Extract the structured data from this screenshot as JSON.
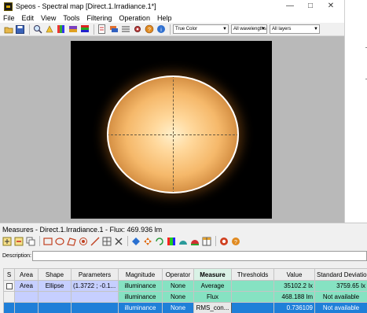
{
  "window": {
    "title": "Speos - Spectral map [Direct.1.Irradiance.1*]",
    "controls": {
      "minimize": "—",
      "maximize": "□",
      "close": "✕"
    }
  },
  "menu": [
    "File",
    "Edit",
    "View",
    "Tools",
    "Filtering",
    "Operation",
    "Help"
  ],
  "toolbar": {
    "color_mode": "True Color",
    "wavelength": "All wavelengths",
    "layers": "All layers"
  },
  "measures": {
    "title": "Measures - Direct.1.Irradiance.1 - Flux: 469.936 lm",
    "description_label": "Description:",
    "description_value": "",
    "columns": [
      "S",
      "Area",
      "Shape",
      "Parameters",
      "Magnitude",
      "Operator",
      "Measure",
      "Thresholds",
      "Value",
      "Standard Deviation"
    ],
    "rows": [
      {
        "area": "Area",
        "shape": "Ellipse",
        "parameters": "(1.3722 ; -0.1...",
        "magnitude": "illuminance",
        "operator": "None",
        "measure": "Average",
        "thresholds": "",
        "value": "35102.2 lx",
        "std_dev": "3759.65 lx"
      },
      {
        "area": "",
        "shape": "",
        "parameters": "",
        "magnitude": "illuminance",
        "operator": "None",
        "measure": "Flux",
        "thresholds": "",
        "value": "468.188 lm",
        "std_dev": "Not available"
      },
      {
        "area": "",
        "shape": "",
        "parameters": "",
        "magnitude": "illuminance",
        "operator": "None",
        "measure": "RMS_con...",
        "thresholds": "",
        "value": "0.736109",
        "std_dev": "Not available"
      }
    ]
  },
  "colors": {
    "row_blue": "#c6cfff",
    "row_green": "#86e2c2",
    "selected_row": "#1f7fd8"
  }
}
